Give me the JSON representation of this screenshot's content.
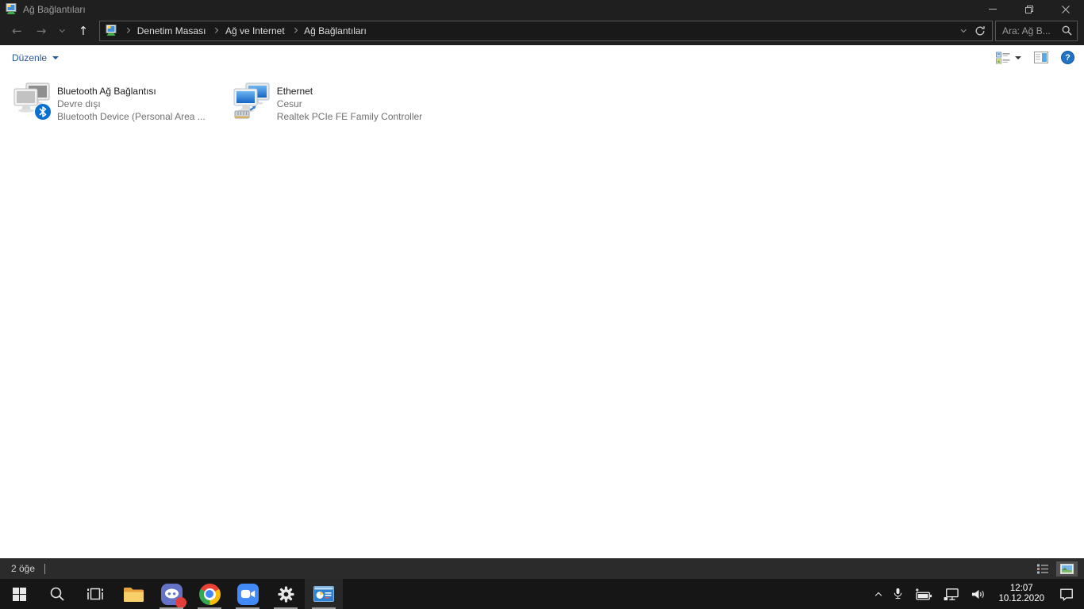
{
  "window": {
    "title": "Ağ Bağlantıları"
  },
  "navbar": {
    "breadcrumbs": [
      "Denetim Masası",
      "Ağ ve Internet",
      "Ağ Bağlantıları"
    ],
    "search_placeholder": "Ara: Ağ B..."
  },
  "toolbar": {
    "edit_label": "Düzenle",
    "help_label": "?"
  },
  "items": [
    {
      "title": "Bluetooth Ağ Bağlantısı",
      "status": "Devre dışı",
      "device": "Bluetooth Device (Personal Area ..."
    },
    {
      "title": "Ethernet",
      "status": "Cesur",
      "device": "Realtek PCIe FE Family Controller"
    }
  ],
  "statusbar": {
    "count": "2 öğe"
  },
  "taskbar": {
    "clock": {
      "time": "12:07",
      "date": "10.12.2020"
    }
  },
  "colors": {
    "accent_blue": "#0a6fd0",
    "toolbar_link": "#26569c",
    "title_bar": "#1f1f1f",
    "status_bar": "#2b2b2b",
    "taskbar": "#161616"
  }
}
